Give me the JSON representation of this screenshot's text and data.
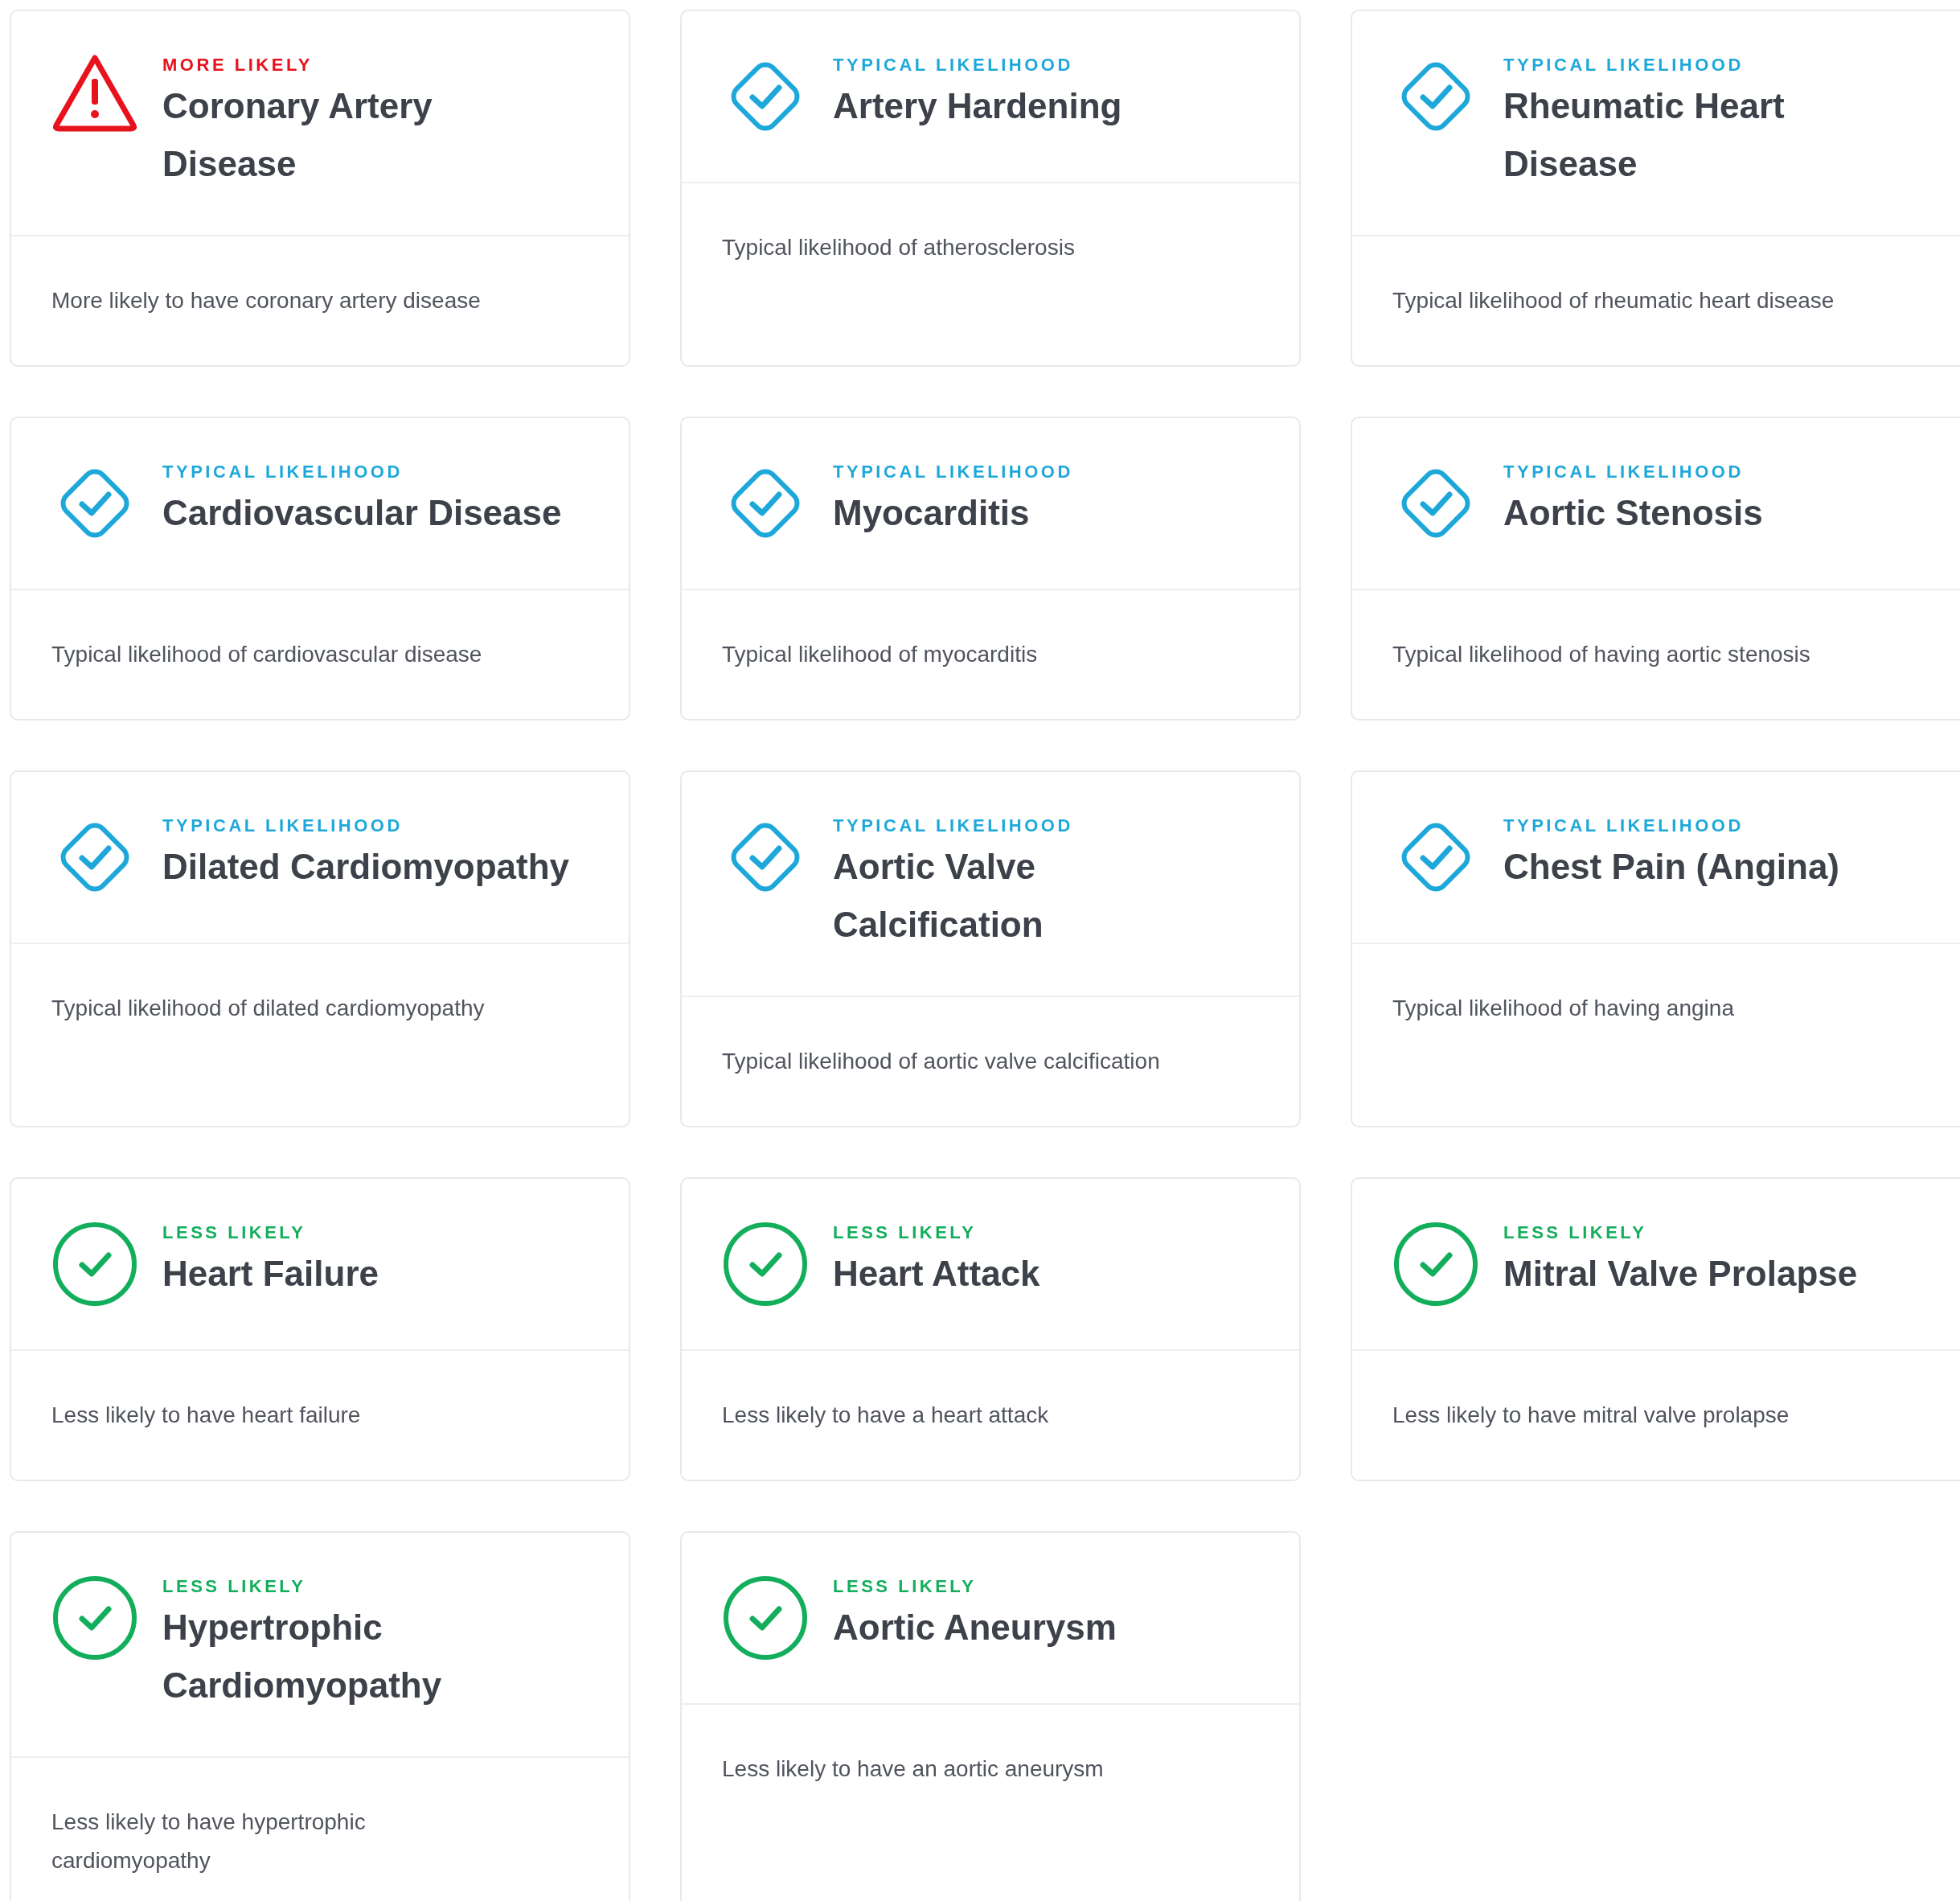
{
  "cards": [
    {
      "kind": "more",
      "label": "MORE LIKELY",
      "title_lines": [
        "Coronary Artery",
        "Disease"
      ],
      "description_lines": [
        "More likely to have coronary artery disease"
      ]
    },
    {
      "kind": "typical",
      "label": "TYPICAL LIKELIHOOD",
      "title_lines": [
        "Artery Hardening"
      ],
      "description_lines": [
        "Typical likelihood of atherosclerosis"
      ]
    },
    {
      "kind": "typical",
      "label": "TYPICAL LIKELIHOOD",
      "title_lines": [
        "Rheumatic Heart",
        "Disease"
      ],
      "description_lines": [
        "Typical likelihood of rheumatic heart disease"
      ]
    },
    {
      "kind": "typical",
      "label": "TYPICAL LIKELIHOOD",
      "title_lines": [
        "Cardiovascular Disease"
      ],
      "description_lines": [
        "Typical likelihood of cardiovascular disease"
      ]
    },
    {
      "kind": "typical",
      "label": "TYPICAL LIKELIHOOD",
      "title_lines": [
        "Myocarditis"
      ],
      "description_lines": [
        "Typical likelihood of myocarditis"
      ]
    },
    {
      "kind": "typical",
      "label": "TYPICAL LIKELIHOOD",
      "title_lines": [
        "Aortic Stenosis"
      ],
      "description_lines": [
        "Typical likelihood of having aortic stenosis"
      ]
    },
    {
      "kind": "typical",
      "label": "TYPICAL LIKELIHOOD",
      "title_lines": [
        "Dilated Cardiomyopathy"
      ],
      "description_lines": [
        "Typical likelihood of dilated cardiomyopathy"
      ]
    },
    {
      "kind": "typical",
      "label": "TYPICAL LIKELIHOOD",
      "title_lines": [
        "Aortic Valve",
        "Calcification"
      ],
      "description_lines": [
        "Typical likelihood of aortic valve calcification"
      ]
    },
    {
      "kind": "typical",
      "label": "TYPICAL LIKELIHOOD",
      "title_lines": [
        "Chest Pain (Angina)"
      ],
      "description_lines": [
        "Typical likelihood of having angina"
      ]
    },
    {
      "kind": "less",
      "label": "LESS LIKELY",
      "title_lines": [
        "Heart Failure"
      ],
      "description_lines": [
        "Less likely to have heart failure"
      ]
    },
    {
      "kind": "less",
      "label": "LESS LIKELY",
      "title_lines": [
        "Heart Attack"
      ],
      "description_lines": [
        "Less likely to have a heart attack"
      ]
    },
    {
      "kind": "less",
      "label": "LESS LIKELY",
      "title_lines": [
        "Mitral Valve Prolapse"
      ],
      "description_lines": [
        "Less likely to have mitral valve prolapse"
      ]
    },
    {
      "kind": "less",
      "label": "LESS LIKELY",
      "title_lines": [
        "Hypertrophic",
        "Cardiomyopathy"
      ],
      "description_lines": [
        "Less likely to have hypertrophic",
        "cardiomyopathy"
      ]
    },
    {
      "kind": "less",
      "label": "LESS LIKELY",
      "title_lines": [
        "Aortic Aneurysm"
      ],
      "description_lines": [
        "Less likely to have an aortic aneurysm"
      ]
    }
  ]
}
